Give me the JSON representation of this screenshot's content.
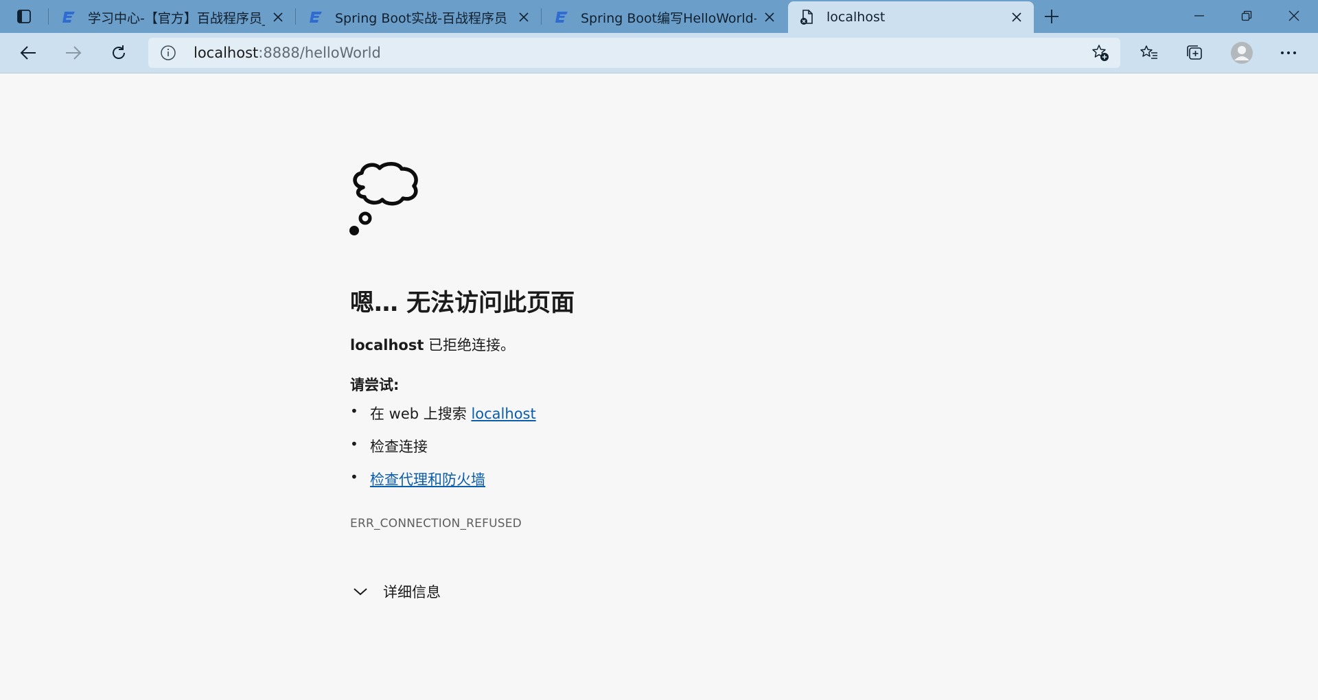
{
  "browser": {
    "tabs": [
      {
        "title": "学习中心-【官方】百战程序员_IT",
        "favicon": "bz-logo-icon",
        "active": false
      },
      {
        "title": "Spring Boot实战-百战程序员",
        "favicon": "bz-logo-icon",
        "active": false
      },
      {
        "title": "Spring Boot编写HelloWorld-【官",
        "favicon": "bz-logo-icon",
        "active": false
      },
      {
        "title": "localhost",
        "favicon": "broken-page-icon",
        "active": true
      }
    ],
    "address": {
      "host": "localhost",
      "rest": ":8888/helloWorld"
    },
    "colors": {
      "tabstrip": "#6b9ec9",
      "toolbar": "#cde0ef",
      "page_background": "#f7f7f7",
      "link": "#0a5cad"
    }
  },
  "error_page": {
    "icon": "thought-cloud-icon",
    "heading": "嗯… 无法访问此页面",
    "message_host": "localhost",
    "message_text": " 已拒绝连接。",
    "try_label": "请尝试:",
    "suggestions": {
      "search_prefix": "在 web 上搜索 ",
      "search_link": "localhost",
      "check_connection": "检查连接",
      "check_proxy": "检查代理和防火墙"
    },
    "error_code": "ERR_CONNECTION_REFUSED",
    "details_label": "详细信息"
  }
}
